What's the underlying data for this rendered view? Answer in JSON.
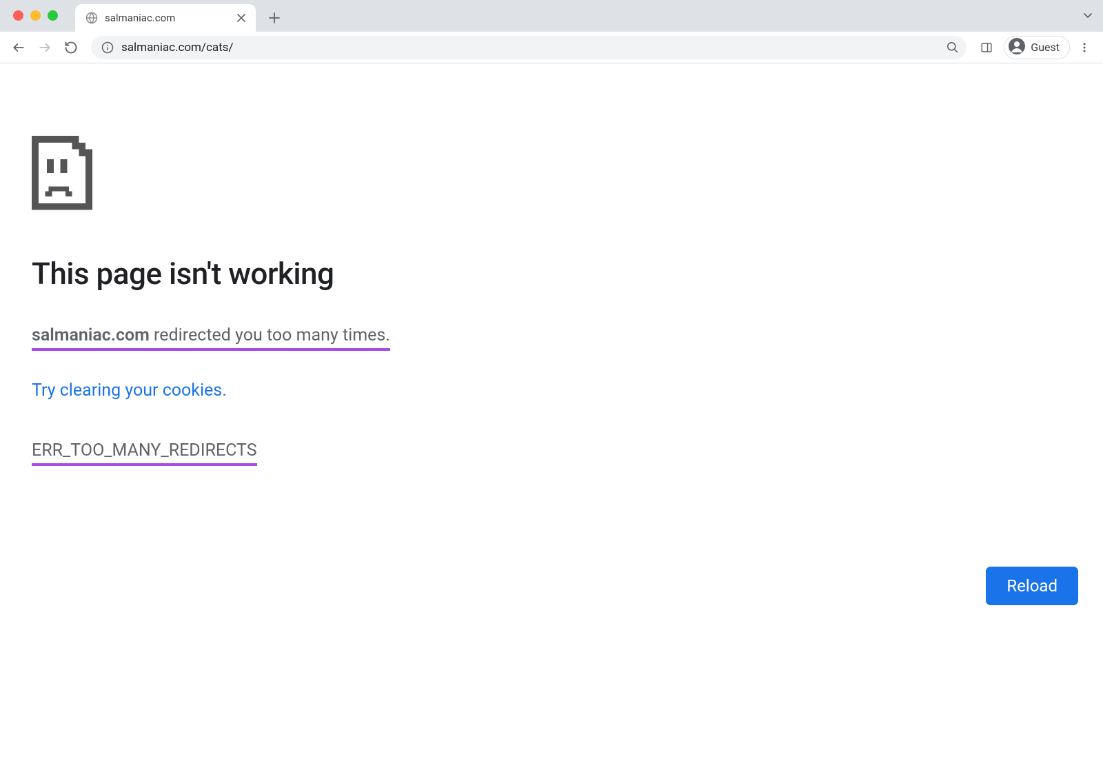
{
  "window": {
    "tab_title": "salmaniac.com",
    "profile_label": "Guest"
  },
  "omnibox": {
    "url": "salmaniac.com/cats/"
  },
  "error": {
    "title": "This page isn't working",
    "host": "salmaniac.com",
    "redirect_msg": " redirected you too many times.",
    "cookies_link": "Try clearing your cookies",
    "cookies_period": ".",
    "code": "ERR_TOO_MANY_REDIRECTS",
    "reload_label": "Reload"
  }
}
